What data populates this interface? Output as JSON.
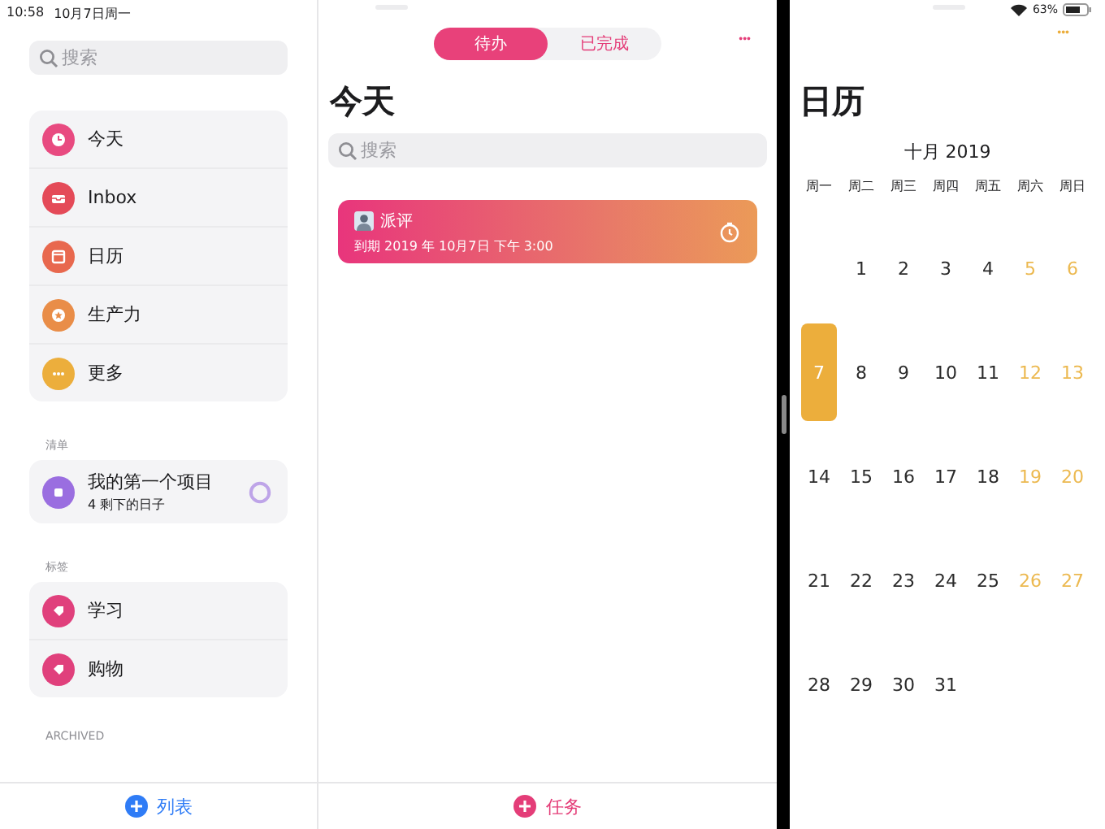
{
  "status_bar": {
    "time": "10:58",
    "date": "10月7日周一",
    "battery": "63%"
  },
  "sidebar": {
    "search": {
      "placeholder": "搜索"
    },
    "items": [
      {
        "label": "今天",
        "color": "#e84a80"
      },
      {
        "label": "Inbox",
        "color": "#e44a58"
      },
      {
        "label": "日历",
        "color": "#e8684e"
      },
      {
        "label": "生产力",
        "color": "#e98d48"
      },
      {
        "label": "更多",
        "color": "#ecae3c"
      }
    ],
    "lists_heading": "清单",
    "lists": [
      {
        "title": "我的第一个项目",
        "subtitle": "4 剩下的日子",
        "color": "#9a6ee0"
      }
    ],
    "tags_heading": "标签",
    "tags": [
      {
        "label": "学习",
        "color": "#e0407c"
      },
      {
        "label": "购物",
        "color": "#e0407c"
      }
    ],
    "archived_heading": "ARCHIVED",
    "add_button": "列表"
  },
  "main": {
    "tabs": [
      {
        "label": "待办",
        "selected": true
      },
      {
        "label": "已完成",
        "selected": false
      }
    ],
    "more": "•••",
    "title": "今天",
    "search": {
      "placeholder": "搜索"
    },
    "tasks": [
      {
        "title": "派评",
        "due": "到期 2019 年 10月7日 下午 3:00"
      }
    ],
    "add_button": "任务"
  },
  "calendar": {
    "more": "•••",
    "title": "日历",
    "month": "十月 2019",
    "weekdays": [
      {
        "label": "周一"
      },
      {
        "label": "周二"
      },
      {
        "label": "周三"
      },
      {
        "label": "周四"
      },
      {
        "label": "周五"
      },
      {
        "label": "周六"
      },
      {
        "label": "周日"
      }
    ],
    "weeks": [
      [
        {
          "day": "1",
          "weekend": false,
          "selected": false
        },
        {
          "day": "2",
          "weekend": false,
          "selected": false
        },
        {
          "day": "3",
          "weekend": false,
          "selected": false
        },
        {
          "day": "4",
          "weekend": false,
          "selected": false
        },
        {
          "day": "5",
          "weekend": true,
          "selected": false
        },
        {
          "day": "6",
          "weekend": true,
          "selected": false
        }
      ],
      [
        {
          "day": "7",
          "weekend": false,
          "selected": true
        },
        {
          "day": "8",
          "weekend": false,
          "selected": false
        },
        {
          "day": "9",
          "weekend": false,
          "selected": false
        },
        {
          "day": "10",
          "weekend": false,
          "selected": false
        },
        {
          "day": "11",
          "weekend": false,
          "selected": false
        },
        {
          "day": "12",
          "weekend": true,
          "selected": false
        },
        {
          "day": "13",
          "weekend": true,
          "selected": false
        }
      ],
      [
        {
          "day": "14",
          "weekend": false,
          "selected": false
        },
        {
          "day": "15",
          "weekend": false,
          "selected": false
        },
        {
          "day": "16",
          "weekend": false,
          "selected": false
        },
        {
          "day": "17",
          "weekend": false,
          "selected": false
        },
        {
          "day": "18",
          "weekend": false,
          "selected": false
        },
        {
          "day": "19",
          "weekend": true,
          "selected": false
        },
        {
          "day": "20",
          "weekend": true,
          "selected": false
        }
      ],
      [
        {
          "day": "21",
          "weekend": false,
          "selected": false
        },
        {
          "day": "22",
          "weekend": false,
          "selected": false
        },
        {
          "day": "23",
          "weekend": false,
          "selected": false
        },
        {
          "day": "24",
          "weekend": false,
          "selected": false
        },
        {
          "day": "25",
          "weekend": false,
          "selected": false
        },
        {
          "day": "26",
          "weekend": true,
          "selected": false
        },
        {
          "day": "27",
          "weekend": true,
          "selected": false
        }
      ],
      [
        {
          "day": "28",
          "weekend": false,
          "selected": false
        },
        {
          "day": "29",
          "weekend": false,
          "selected": false
        },
        {
          "day": "30",
          "weekend": false,
          "selected": false
        },
        {
          "day": "31",
          "weekend": false,
          "selected": false
        }
      ]
    ]
  }
}
